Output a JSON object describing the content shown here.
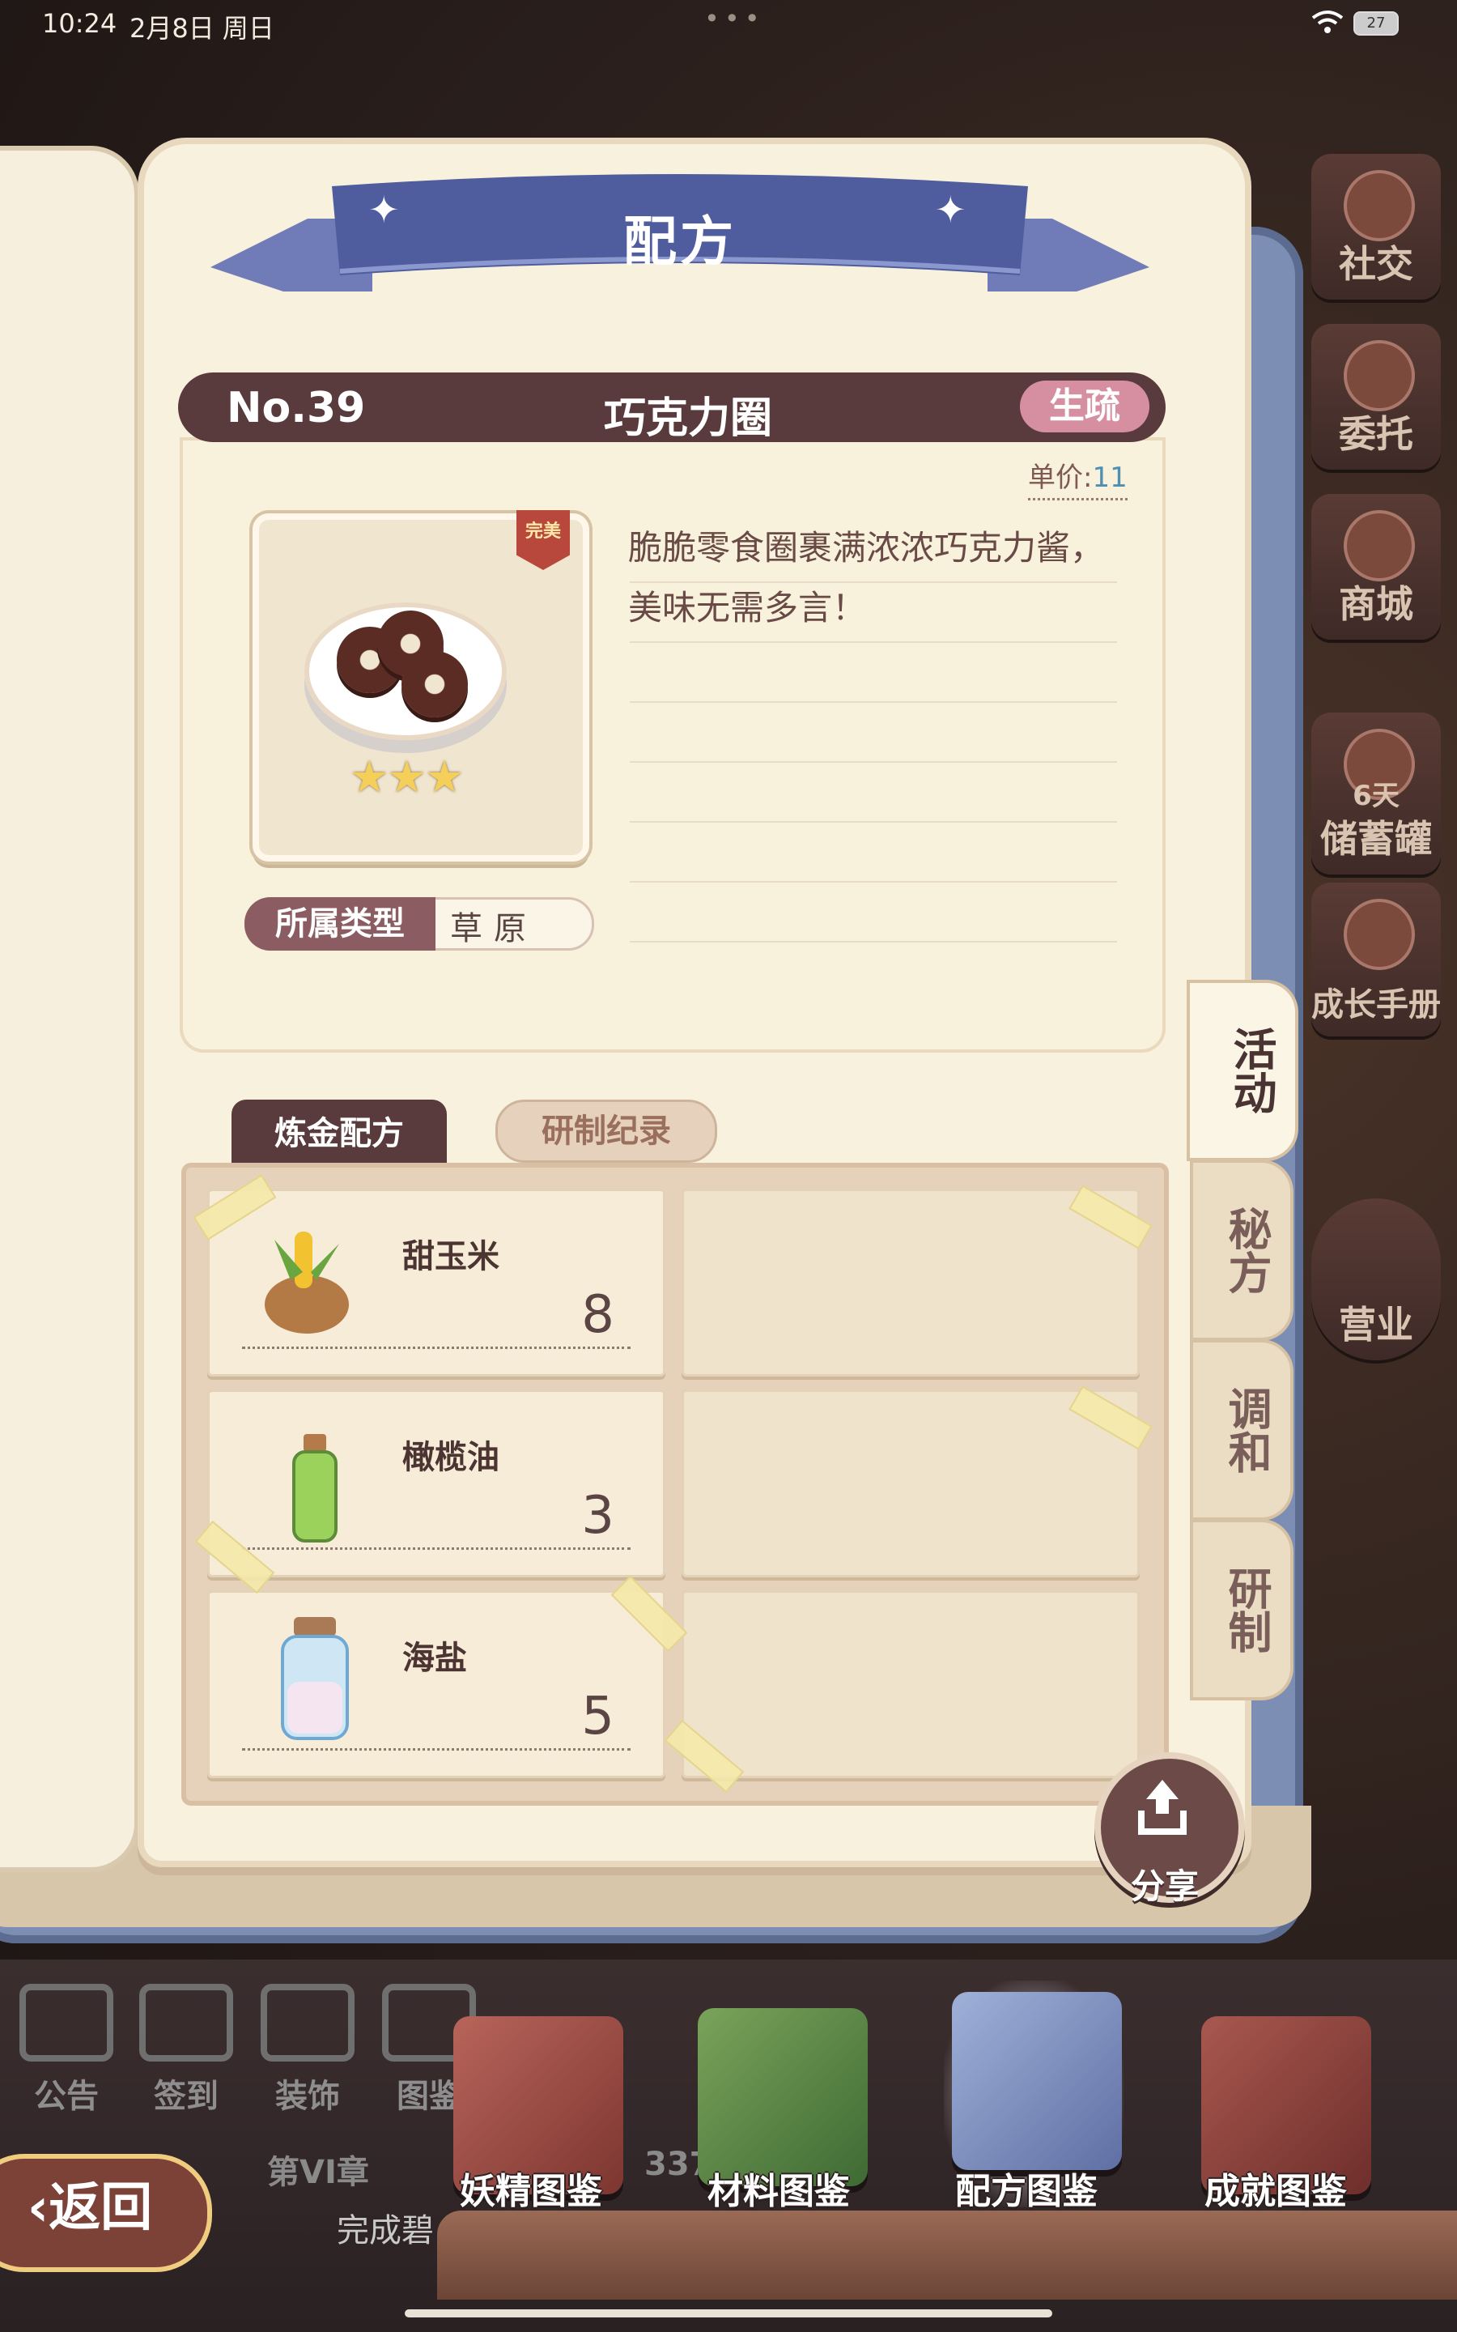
{
  "status_bar": {
    "time": "10:24",
    "date": "2月8日 周日",
    "battery": "27"
  },
  "side_menu": [
    {
      "label": "社交",
      "icon": "social-icon"
    },
    {
      "label": "委托",
      "icon": "commission-icon"
    },
    {
      "label": "商城",
      "icon": "shop-icon"
    },
    {
      "label": "6天",
      "icon": "piggy-bank-icon"
    },
    {
      "label": "储蓄罐",
      "icon": "piggy-bank-icon"
    },
    {
      "label": "成长手册",
      "icon": "growth-book-icon"
    },
    {
      "label": "营业",
      "icon": "business-icon"
    }
  ],
  "ribbon": {
    "title": "配方"
  },
  "recipe": {
    "number": "No.39",
    "name": "巧克力圈",
    "level": "生疏",
    "price_label": "单价:",
    "price_value": "11",
    "badge": "完美",
    "stars": 3,
    "stars_text": "★★★",
    "type_label": "所属类型",
    "type_value": "草原",
    "description_line1": "脆脆零食圈裹满浓浓巧克力酱，",
    "description_line2": "美味无需多言！"
  },
  "tabs": {
    "formula": "炼金配方",
    "record": "研制纪录"
  },
  "ingredients": [
    {
      "name": "甜玉米",
      "qty": "8",
      "icon": "corn-sack-icon"
    },
    {
      "name": "橄榄油",
      "qty": "3",
      "icon": "olive-oil-bottle-icon"
    },
    {
      "name": "海盐",
      "qty": "5",
      "icon": "sea-salt-jar-icon"
    }
  ],
  "side_tabs": [
    "活动",
    "秘方",
    "调和",
    "研制"
  ],
  "share": {
    "label": "分享"
  },
  "bottom": {
    "mini_buttons": [
      "公告",
      "签到",
      "装饰",
      "图鉴"
    ],
    "categories": [
      "妖精图鉴",
      "材料图鉴",
      "配方图鉴",
      "成就图鉴"
    ],
    "selected_category": "配方图鉴",
    "back": "返回",
    "chapter": "第VI章",
    "chapter_value": "337",
    "complete_text": "完成碧"
  },
  "colors": {
    "header_bg": "#5a3b3d",
    "level_badge": "#d68fa0",
    "ribbon": "#4f5d9e",
    "price_value": "#4e8fb2",
    "page": "#f8f1dd"
  }
}
